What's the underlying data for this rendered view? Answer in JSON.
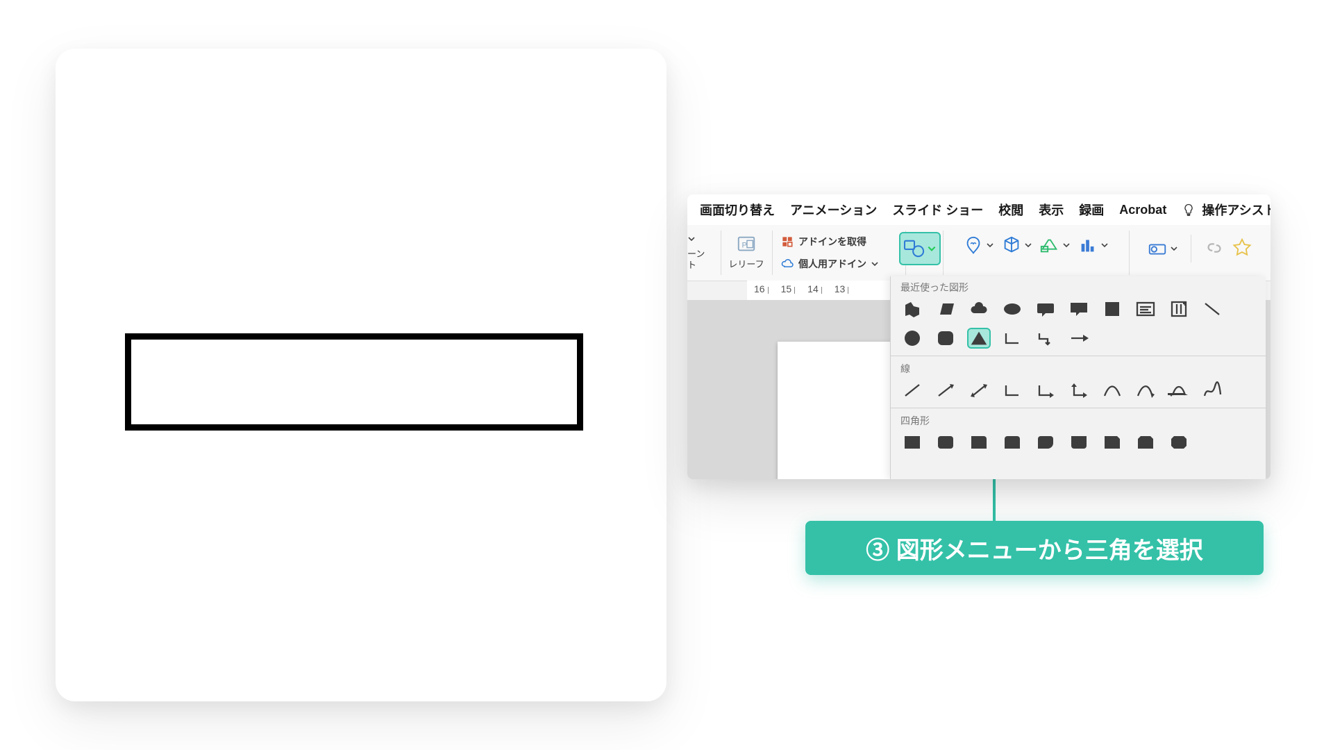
{
  "tabs": {
    "transition": "画面切り替え",
    "animation": "アニメーション",
    "slideshow": "スライド ショー",
    "review": "校閲",
    "view": "表示",
    "record": "録画",
    "acrobat": "Acrobat",
    "assist": "操作アシスト"
  },
  "ribbon": {
    "truncated_text_1": "ーン",
    "truncated_text_2": "ト",
    "relief": "レリーフ",
    "get_addins": "アドインを取得",
    "personal_addins": "個人用アドイン"
  },
  "ruler_ticks": [
    "16",
    "15",
    "14",
    "13"
  ],
  "shapes_dd": {
    "recent": "最近使った図形",
    "lines": "線",
    "rects": "四角形"
  },
  "callout": "③ 図形メニューから三角を選択",
  "colors": {
    "accent": "#34c1a8",
    "accent_light": "#a8e7dc"
  }
}
